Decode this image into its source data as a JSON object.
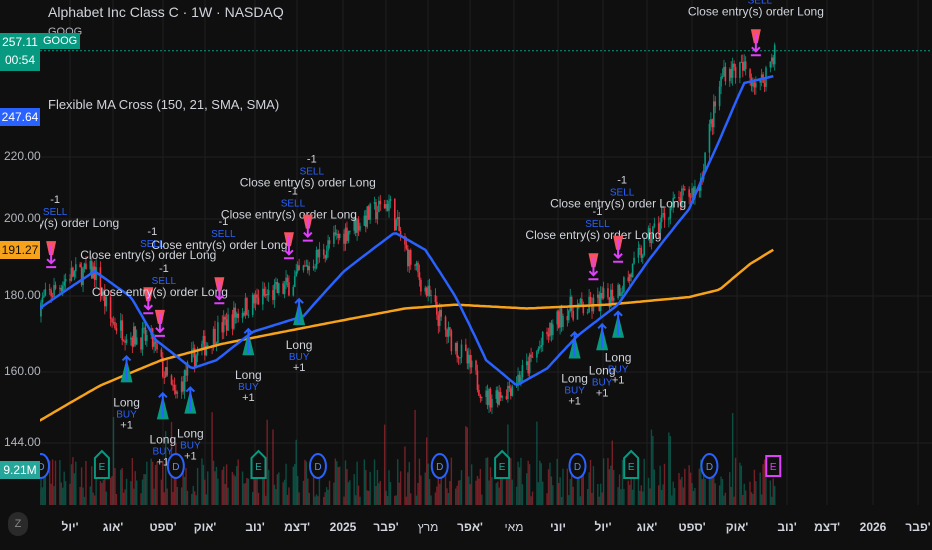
{
  "header": {
    "title": "Alphabet Inc Class C · 1W · NASDAQ",
    "symbol": "GOOG",
    "indicator": "Flexible MA Cross (150, 21, SMA, SMA)"
  },
  "price_badges": {
    "last_price": "257.11",
    "countdown": "00:54",
    "fast_ma": "247.64",
    "slow_ma": "191.27",
    "volume": "9.21M"
  },
  "colors": {
    "up": "#089981",
    "down": "#f23645",
    "fast_ma": "#2962ff",
    "slow_ma": "#f7a21b",
    "buy": "#2962ff",
    "sell": "#e040fb",
    "earnings_future": "#e040fb",
    "dividend": "#2962ff",
    "earnings": "#089981"
  },
  "chart_data": {
    "type": "candlestick",
    "title": "",
    "scale": "log",
    "grid": true,
    "y_ticks": [
      "220.00",
      "200.00",
      "180.00",
      "160.00",
      "144.00"
    ],
    "x_ticks": [
      "יול'",
      "אוג'",
      "ספט'",
      "אוק'",
      "נוב'",
      "דצמ'",
      "2025",
      "פבר'",
      "מרץ",
      "אפר'",
      "מאי",
      "יוני",
      "יול'",
      "אוג'",
      "ספט'",
      "אוק'",
      "נוב'",
      "דצמ'",
      "2026",
      "פבר'"
    ],
    "close": [
      [
        "2024-06-10",
        176
      ],
      [
        "2024-07-01",
        184
      ],
      [
        "2024-07-18",
        185
      ],
      [
        "2024-07-29",
        172
      ],
      [
        "2024-08-12",
        168
      ],
      [
        "2024-08-26",
        167
      ],
      [
        "2024-09-05",
        158
      ],
      [
        "2024-09-12",
        153
      ],
      [
        "2024-09-23",
        162
      ],
      [
        "2024-10-10",
        169
      ],
      [
        "2024-10-28",
        175
      ],
      [
        "2024-11-11",
        178
      ],
      [
        "2024-11-25",
        180
      ],
      [
        "2024-12-09",
        185
      ],
      [
        "2024-12-23",
        191
      ],
      [
        "2025-01-09",
        197
      ],
      [
        "2025-02-06",
        205
      ],
      [
        "2025-02-17",
        191
      ],
      [
        "2025-03-03",
        180
      ],
      [
        "2025-03-17",
        169
      ],
      [
        "2025-03-31",
        162
      ],
      [
        "2025-04-14",
        153
      ],
      [
        "2025-04-28",
        155
      ],
      [
        "2025-05-12",
        160
      ],
      [
        "2025-05-26",
        168
      ],
      [
        "2025-06-09",
        175
      ],
      [
        "2025-06-23",
        175
      ],
      [
        "2025-07-07",
        178
      ],
      [
        "2025-07-21",
        183
      ],
      [
        "2025-08-04",
        194
      ],
      [
        "2025-08-18",
        203
      ],
      [
        "2025-09-08",
        210
      ],
      [
        "2025-09-15",
        228
      ],
      [
        "2025-09-25",
        250
      ],
      [
        "2025-10-09",
        250
      ],
      [
        "2025-10-20",
        244
      ],
      [
        "2025-10-30",
        257.11
      ]
    ],
    "fast_ma": {
      "name": "",
      "values": [
        [
          "2024-06-10",
          175
        ],
        [
          "2024-07-18",
          185
        ],
        [
          "2024-08-12",
          178
        ],
        [
          "2024-08-29",
          167
        ],
        [
          "2024-09-23",
          160
        ],
        [
          "2024-10-10",
          162
        ],
        [
          "2024-11-04",
          169
        ],
        [
          "2024-12-09",
          173
        ],
        [
          "2025-01-06",
          185
        ],
        [
          "2025-02-10",
          196
        ],
        [
          "2025-03-03",
          191
        ],
        [
          "2025-03-24",
          178
        ],
        [
          "2025-04-14",
          162
        ],
        [
          "2025-05-05",
          156
        ],
        [
          "2025-05-26",
          160
        ],
        [
          "2025-06-16",
          168
        ],
        [
          "2025-06-30",
          172
        ],
        [
          "2025-07-14",
          176
        ],
        [
          "2025-08-04",
          188
        ],
        [
          "2025-09-01",
          203
        ],
        [
          "2025-09-22",
          225
        ],
        [
          "2025-10-09",
          245
        ],
        [
          "2025-10-30",
          247.64
        ]
      ]
    },
    "slow_ma": {
      "name": "",
      "values": [
        [
          "2024-06-10",
          148
        ],
        [
          "2024-07-22",
          156
        ],
        [
          "2024-09-02",
          162
        ],
        [
          "2024-10-14",
          166
        ],
        [
          "2024-11-25",
          169
        ],
        [
          "2025-01-06",
          172
        ],
        [
          "2025-02-17",
          175
        ],
        [
          "2025-03-24",
          176
        ],
        [
          "2025-05-12",
          175
        ],
        [
          "2025-07-07",
          176
        ],
        [
          "2025-09-01",
          178
        ],
        [
          "2025-09-22",
          180
        ],
        [
          "2025-10-13",
          187
        ],
        [
          "2025-10-30",
          191.27
        ]
      ]
    },
    "sell_signals": {
      "dates": [
        "2024-06-18",
        "2024-08-24",
        "2024-09-01",
        "2024-10-12",
        "2024-11-29",
        "2024-12-12",
        "2025-06-27",
        "2025-07-14",
        "2025-10-17"
      ],
      "label": "Close entry(s) order Long",
      "tag": "SELL",
      "qty": "-1"
    },
    "buy_signals": {
      "dates": [
        "2024-08-09",
        "2024-09-03",
        "2024-09-22",
        "2024-11-01",
        "2024-12-06",
        "2025-06-14",
        "2025-07-03",
        "2025-07-14"
      ],
      "label": "Long",
      "tag": "BUY",
      "qty": "+1"
    },
    "events": {
      "dividends": [
        "2024-06-11",
        "2024-09-12",
        "2024-12-19",
        "2025-03-13",
        "2025-06-16",
        "2025-09-15"
      ],
      "earnings": [
        "2024-07-23",
        "2024-11-08",
        "2025-04-25",
        "2025-07-23"
      ],
      "earnings_upcoming": [
        "2025-10-29"
      ],
      "dividend_letter": "D",
      "earnings_letter": "E"
    }
  },
  "footer": {
    "timezone_button": "Z"
  }
}
